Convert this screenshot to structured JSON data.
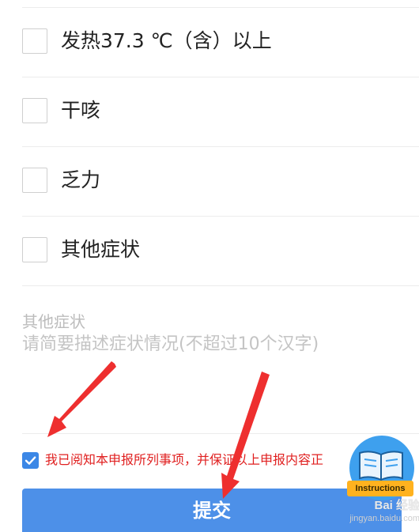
{
  "symptoms": {
    "options": [
      {
        "label": "发热37.3 ℃（含）以上",
        "checked": false
      },
      {
        "label": "干咳",
        "checked": false
      },
      {
        "label": "乏力",
        "checked": false
      },
      {
        "label": "其他症状",
        "checked": false
      }
    ]
  },
  "other_symptoms": {
    "title": "其他症状",
    "placeholder": "请简要描述症状情况(不超过10个汉字)",
    "value": ""
  },
  "agreement": {
    "checked": true,
    "text": "我已阅知本申报所列事项，并保证以上申报内容正"
  },
  "submit": {
    "label": "提交"
  },
  "watermark": {
    "tag": "Instructions",
    "brand": "Bai 经验",
    "url": "jingyan.baidu.com"
  },
  "colors": {
    "accent": "#4d90e8",
    "checkbox_checked": "#3b87e6",
    "agreement_text": "#e02020",
    "annotation_arrow": "#ee2f2f"
  }
}
